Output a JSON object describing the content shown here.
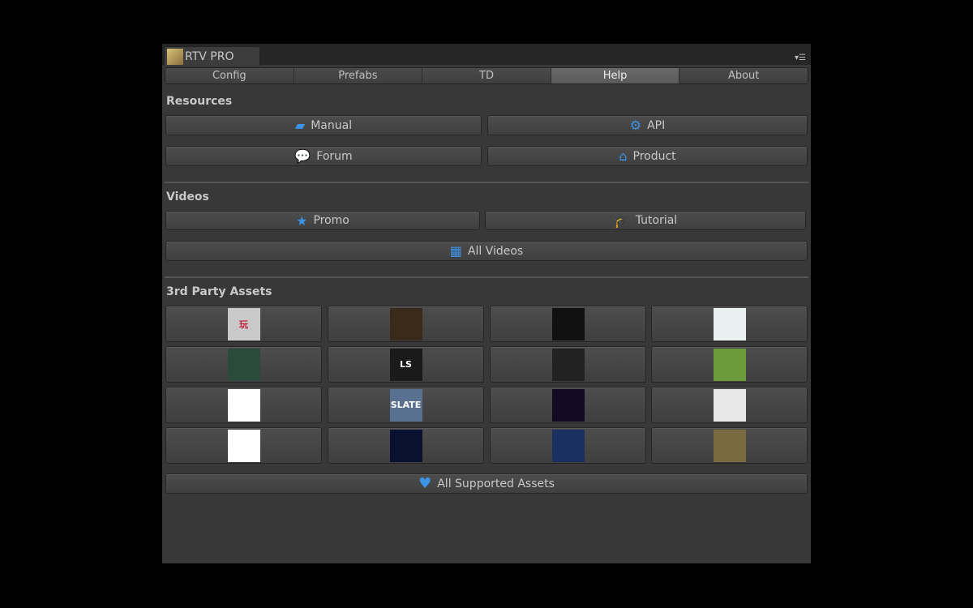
{
  "window": {
    "tab_title": "RTV PRO",
    "menu_icon": "dropdown-menu-icon"
  },
  "tabs": [
    {
      "label": "Config"
    },
    {
      "label": "Prefabs"
    },
    {
      "label": "TD"
    },
    {
      "label": "Help",
      "selected": true
    },
    {
      "label": "About"
    }
  ],
  "resources": {
    "title": "Resources",
    "buttons": [
      {
        "label": "Manual",
        "icon": "book-icon"
      },
      {
        "label": "API",
        "icon": "gears-icon"
      },
      {
        "label": "Forum",
        "icon": "comments-icon"
      },
      {
        "label": "Product",
        "icon": "home-icon"
      }
    ]
  },
  "videos": {
    "title": "Videos",
    "buttons": [
      {
        "label": "Promo",
        "icon": "star-icon"
      },
      {
        "label": "Tutorial",
        "icon": "graduation-cap-icon"
      },
      {
        "label": "All Videos",
        "icon": "film-icon"
      }
    ]
  },
  "assets": {
    "title": "3rd Party Assets",
    "items": [
      {
        "icon": "playmaker-logo",
        "text": "玩",
        "bg": "#c9c9c9",
        "fg": "#c0203a"
      },
      {
        "icon": "adventure-creator-logo",
        "text": "",
        "bg": "#3a2a1a",
        "fg": "#e0b050"
      },
      {
        "icon": "megaphone-logo",
        "text": "",
        "bg": "#111",
        "fg": "#fff"
      },
      {
        "icon": "dialogue-system-logo",
        "text": "",
        "bg": "#e8f0f0",
        "fg": "#4ab"
      },
      {
        "icon": "game-scene-logo",
        "text": "",
        "bg": "#2a4a3a",
        "fg": "#ccc"
      },
      {
        "icon": "ls-pro-logo",
        "text": "LS",
        "bg": "#1a1a1a",
        "fg": "#fff"
      },
      {
        "icon": "npc-chat-logo",
        "text": "",
        "bg": "#222",
        "fg": "#f0a020"
      },
      {
        "icon": "salad-logo",
        "text": "",
        "bg": "#6a9a3a",
        "fg": "#d33"
      },
      {
        "icon": "salsa-lipsync-logo",
        "text": "",
        "bg": "#fff",
        "fg": "#1a5fb0"
      },
      {
        "icon": "slate-logo",
        "text": "SLATE",
        "bg": "#5a7090",
        "fg": "#fff"
      },
      {
        "icon": "amplitude-webgl-logo",
        "text": "",
        "bg": "#150a25",
        "fg": "#a0f"
      },
      {
        "icon": "speech-synth-logo",
        "text": "",
        "bg": "#e8e8e8",
        "fg": "#c00"
      },
      {
        "icon": "voice-chat-logo",
        "text": "",
        "bg": "#fff",
        "fg": "#333"
      },
      {
        "icon": "audio-wave-logo",
        "text": "",
        "bg": "#0a1030",
        "fg": "#6af"
      },
      {
        "icon": "radio-tower-logo",
        "text": "",
        "bg": "#1a3060",
        "fg": "#e0b040"
      },
      {
        "icon": "coin-logo",
        "text": "",
        "bg": "#7a6a40",
        "fg": "#ddd"
      }
    ],
    "all_button": {
      "label": "All Supported Assets",
      "icon": "heart-icon"
    }
  },
  "colors": {
    "accent": "#3d93e6",
    "panel": "#383838"
  }
}
